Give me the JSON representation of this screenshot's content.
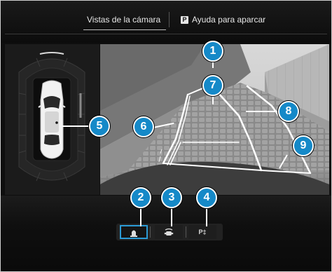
{
  "tabs": {
    "camera_views": "Vistas de la cámara",
    "parking_icon": "P",
    "parking_assist": "Ayuda para aparcar"
  },
  "view_buttons": {
    "park_label": "P‡"
  },
  "callouts": [
    "1",
    "2",
    "3",
    "4",
    "5",
    "6",
    "7",
    "8",
    "9"
  ],
  "colors": {
    "accent": "#1589c8",
    "selected_border": "#2b9bd6",
    "guide_lines": "#ffffff"
  },
  "icons": {
    "top_view": "car-top-view-icon",
    "front_view": "car-front-view-icon",
    "parking": "parking-assist-icon"
  }
}
